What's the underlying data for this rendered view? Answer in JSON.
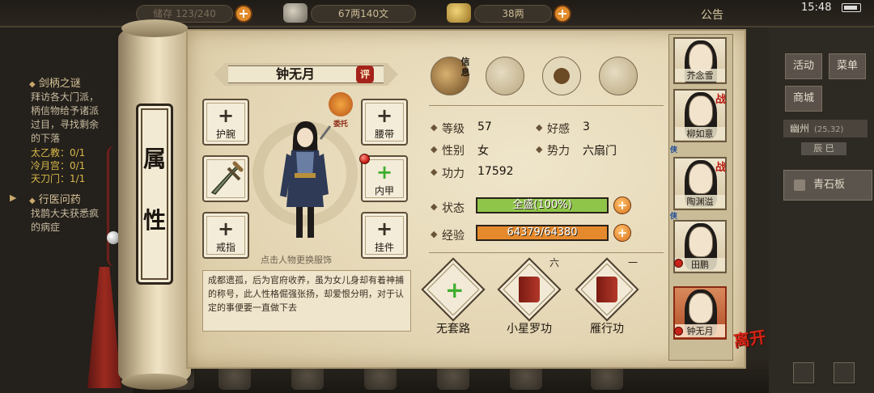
{
  "hud": {
    "resource1_label": "储存",
    "resource1_value": "123/240",
    "copper": "67两140文",
    "silver": "38两",
    "announcement": "公告",
    "time": "15:48"
  },
  "quest_panel": {
    "quest1_title": "剑柄之谜",
    "quest1_lines": [
      "拜访各大门派，",
      "柄信物给予诸派",
      "过目，寻找剩余",
      "的下落"
    ],
    "counts": [
      "太乙教：0/1",
      "冷月宫：0/1",
      "天刀门：1/1"
    ],
    "quest2_title": "行医问药",
    "quest2_lines": [
      "找鹊大夫获悉疯",
      "的病症"
    ]
  },
  "right_hud": {
    "activity": "活动",
    "menu": "菜单",
    "shop": "商城",
    "location": "幽州",
    "coords": "(25,32)",
    "time_chip": "辰 巳",
    "quest_item": "青石板"
  },
  "scroll_title": [
    "属",
    "性"
  ],
  "character": {
    "name": "钟无月",
    "eval_badge": "评",
    "commission_label": "委托",
    "change_clothes_hint": "点击人物更换服饰",
    "description": "成都遗孤，后为官府收养，虽为女儿身却有着神捕的称号，此人性格倔强张扬，却爱恨分明，对于认定的事便要一直做下去"
  },
  "equipment": {
    "wrist": "护腕",
    "weapon": "",
    "ring": "戒指",
    "belt": "腰带",
    "armor": "内甲",
    "pendant": "挂件"
  },
  "top_icons": {
    "letter_tag": "信息",
    "icons": [
      "hat-icon",
      "book-scroll-icon",
      "bagua-icon",
      "meridian-body-icon"
    ]
  },
  "stats": {
    "level_label": "等级",
    "level": "57",
    "affinity_label": "好感",
    "affinity": "3",
    "gender_label": "性别",
    "gender": "女",
    "faction_label": "势力",
    "faction": "六扇门",
    "power_label": "功力",
    "power": "17592",
    "status_label": "状态",
    "status_text": "全盛(100%)",
    "status_fraction": 1.0,
    "exp_label": "经验",
    "exp_text": "64379/64380",
    "exp_fraction": 0.99998
  },
  "skills": [
    {
      "name": "无套路",
      "level": ""
    },
    {
      "name": "小星罗功",
      "level": "六"
    },
    {
      "name": "雁行功",
      "level": "一"
    }
  ],
  "roster": [
    {
      "name": "芥念雪",
      "tag": "",
      "war": ""
    },
    {
      "name": "柳如意",
      "tag": "侠",
      "war": "战"
    },
    {
      "name": "陶渊溢",
      "tag": "侠",
      "war": "战"
    },
    {
      "name": "田鹏",
      "tag": "",
      "war": ""
    },
    {
      "name": "钟无月",
      "tag": "",
      "war": ""
    }
  ],
  "leave_button": "离开",
  "colors": {
    "status_bar": "#8fc64a",
    "exp_bar": "#e58a2c",
    "accent_red": "#c21a10"
  }
}
